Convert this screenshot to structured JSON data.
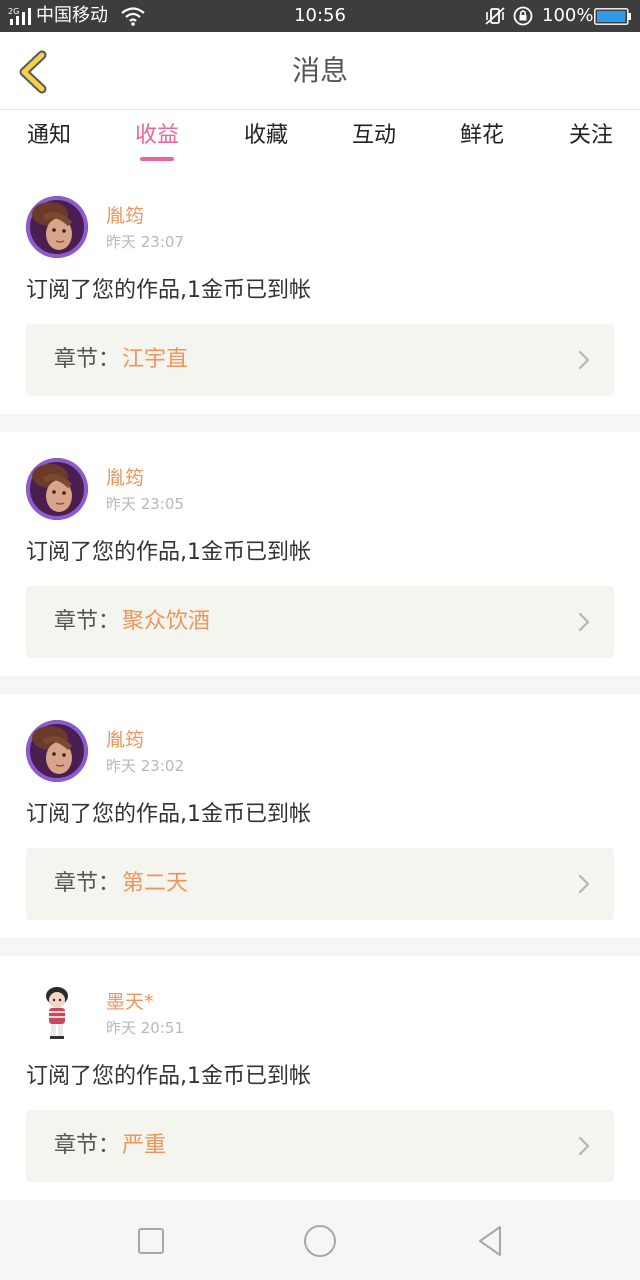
{
  "status_bar": {
    "network": "2G",
    "carrier": "中国移动",
    "time": "10:56",
    "battery": "100%"
  },
  "header": {
    "title": "消息",
    "back_icon": "chevron-left-icon"
  },
  "tabs": [
    {
      "label": "通知",
      "active": false
    },
    {
      "label": "收益",
      "active": true
    },
    {
      "label": "收藏",
      "active": false
    },
    {
      "label": "互动",
      "active": false
    },
    {
      "label": "鲜花",
      "active": false
    },
    {
      "label": "关注",
      "active": false
    }
  ],
  "messages": [
    {
      "user": "胤筠",
      "time": "昨天 23:07",
      "text": "订阅了您的作品,1金币已到帐",
      "chapter_label": "章节：",
      "chapter": "江宇直"
    },
    {
      "user": "胤筠",
      "time": "昨天 23:05",
      "text": "订阅了您的作品,1金币已到帐",
      "chapter_label": "章节：",
      "chapter": "聚众饮酒"
    },
    {
      "user": "胤筠",
      "time": "昨天 23:02",
      "text": "订阅了您的作品,1金币已到帐",
      "chapter_label": "章节：",
      "chapter": "第二天"
    },
    {
      "user": "墨天*",
      "time": "昨天 20:51",
      "text": "订阅了您的作品,1金币已到帐",
      "chapter_label": "章节：",
      "chapter": "严重"
    }
  ],
  "colors": {
    "accent_pink": "#e9659b",
    "accent_orange": "#f0945a",
    "back_icon_yellow": "#f2d24a",
    "chapter_bg": "#f5f5ef"
  },
  "nav_bar": {
    "icons": [
      "square-icon",
      "circle-icon",
      "triangle-back-icon"
    ]
  }
}
